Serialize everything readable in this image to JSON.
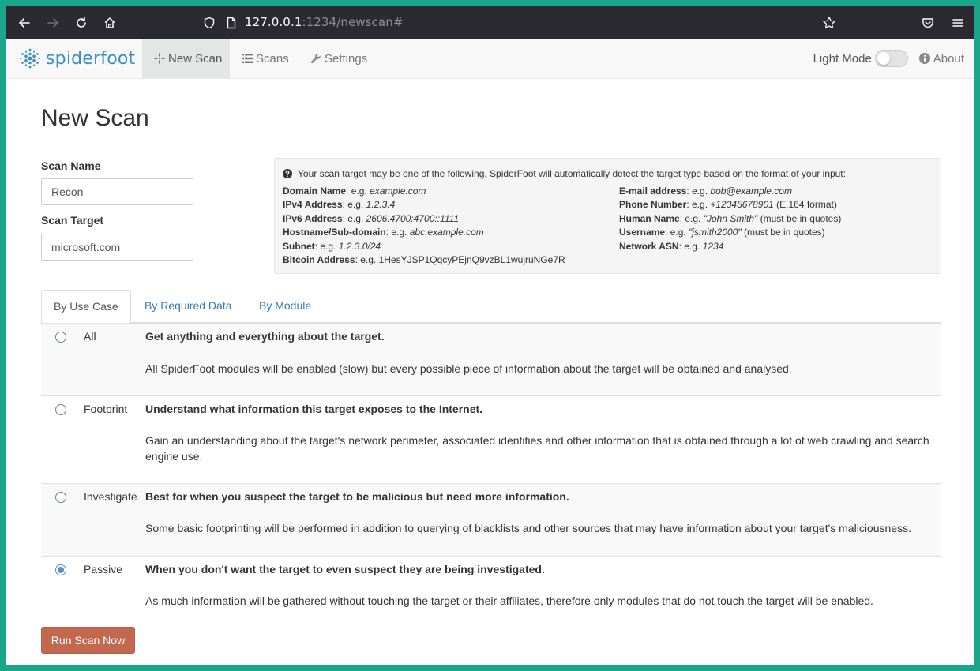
{
  "browser": {
    "url_host": "127.0.0.1",
    "url_port_path": ":1234/newscan#"
  },
  "nav": {
    "brand_a": "spider",
    "brand_b": "foot",
    "tabs": [
      {
        "label": "New Scan",
        "icon": "crosshair-icon"
      },
      {
        "label": "Scans",
        "icon": "list-icon"
      },
      {
        "label": "Settings",
        "icon": "wrench-icon"
      }
    ],
    "light_mode_label": "Light Mode",
    "about_label": "About"
  },
  "page": {
    "title": "New Scan",
    "scan_name_label": "Scan Name",
    "scan_name_value": "Recon",
    "scan_target_label": "Scan Target",
    "scan_target_value": "microsoft.com"
  },
  "help": {
    "intro": "Your scan target may be one of the following. SpiderFoot will automatically detect the target type based on the format of your input:",
    "left": [
      {
        "label": "Domain Name",
        "prefix": ": e.g. ",
        "example": "example.com",
        "suffix": ""
      },
      {
        "label": "IPv4 Address",
        "prefix": ": e.g. ",
        "example": "1.2.3.4",
        "suffix": ""
      },
      {
        "label": "IPv6 Address",
        "prefix": ": e.g. ",
        "example": "2606:4700:4700::1111",
        "suffix": ""
      },
      {
        "label": "Hostname/Sub-domain",
        "prefix": ": e.g. ",
        "example": "abc.example.com",
        "suffix": ""
      },
      {
        "label": "Subnet",
        "prefix": ": e.g. ",
        "example": "1.2.3.0/24",
        "suffix": ""
      },
      {
        "label": "Bitcoin Address",
        "prefix": ": e.g. 1HesYJSP1QqcyPEjnQ9vzBL1wujruNGe7R",
        "example": "",
        "suffix": ""
      }
    ],
    "right": [
      {
        "label": "E-mail address",
        "prefix": ": e.g. ",
        "example": "bob@example.com",
        "suffix": ""
      },
      {
        "label": "Phone Number",
        "prefix": ": e.g. ",
        "example": "+12345678901",
        "suffix": " (E.164 format)"
      },
      {
        "label": "Human Name",
        "prefix": ": e.g. ",
        "example": "\"John Smith\"",
        "suffix": " (must be in quotes)"
      },
      {
        "label": "Username",
        "prefix": ": e.g. ",
        "example": "\"jsmith2000\"",
        "suffix": " (must be in quotes)"
      },
      {
        "label": "Network ASN",
        "prefix": ": e.g. ",
        "example": "1234",
        "suffix": ""
      }
    ]
  },
  "tabs": [
    "By Use Case",
    "By Required Data",
    "By Module"
  ],
  "use_cases": [
    {
      "name": "All",
      "title": "Get anything and everything about the target.",
      "desc": "All SpiderFoot modules will be enabled (slow) but every possible piece of information about the target will be obtained and analysed.",
      "selected": false
    },
    {
      "name": "Footprint",
      "title": "Understand what information this target exposes to the Internet.",
      "desc": "Gain an understanding about the target's network perimeter, associated identities and other information that is obtained through a lot of web crawling and search engine use.",
      "selected": false
    },
    {
      "name": "Investigate",
      "title": "Best for when you suspect the target to be malicious but need more information.",
      "desc": "Some basic footprinting will be performed in addition to querying of blacklists and other sources that may have information about your target's maliciousness.",
      "selected": false
    },
    {
      "name": "Passive",
      "title": "When you don't want the target to even suspect they are being investigated.",
      "desc": "As much information will be gathered without touching the target or their affiliates, therefore only modules that do not touch the target will be enabled.",
      "selected": true
    }
  ],
  "run_button": "Run Scan Now",
  "colors": {
    "brand": "#3a8fc0",
    "run_button": "#c1684f",
    "link": "#337ab7"
  }
}
